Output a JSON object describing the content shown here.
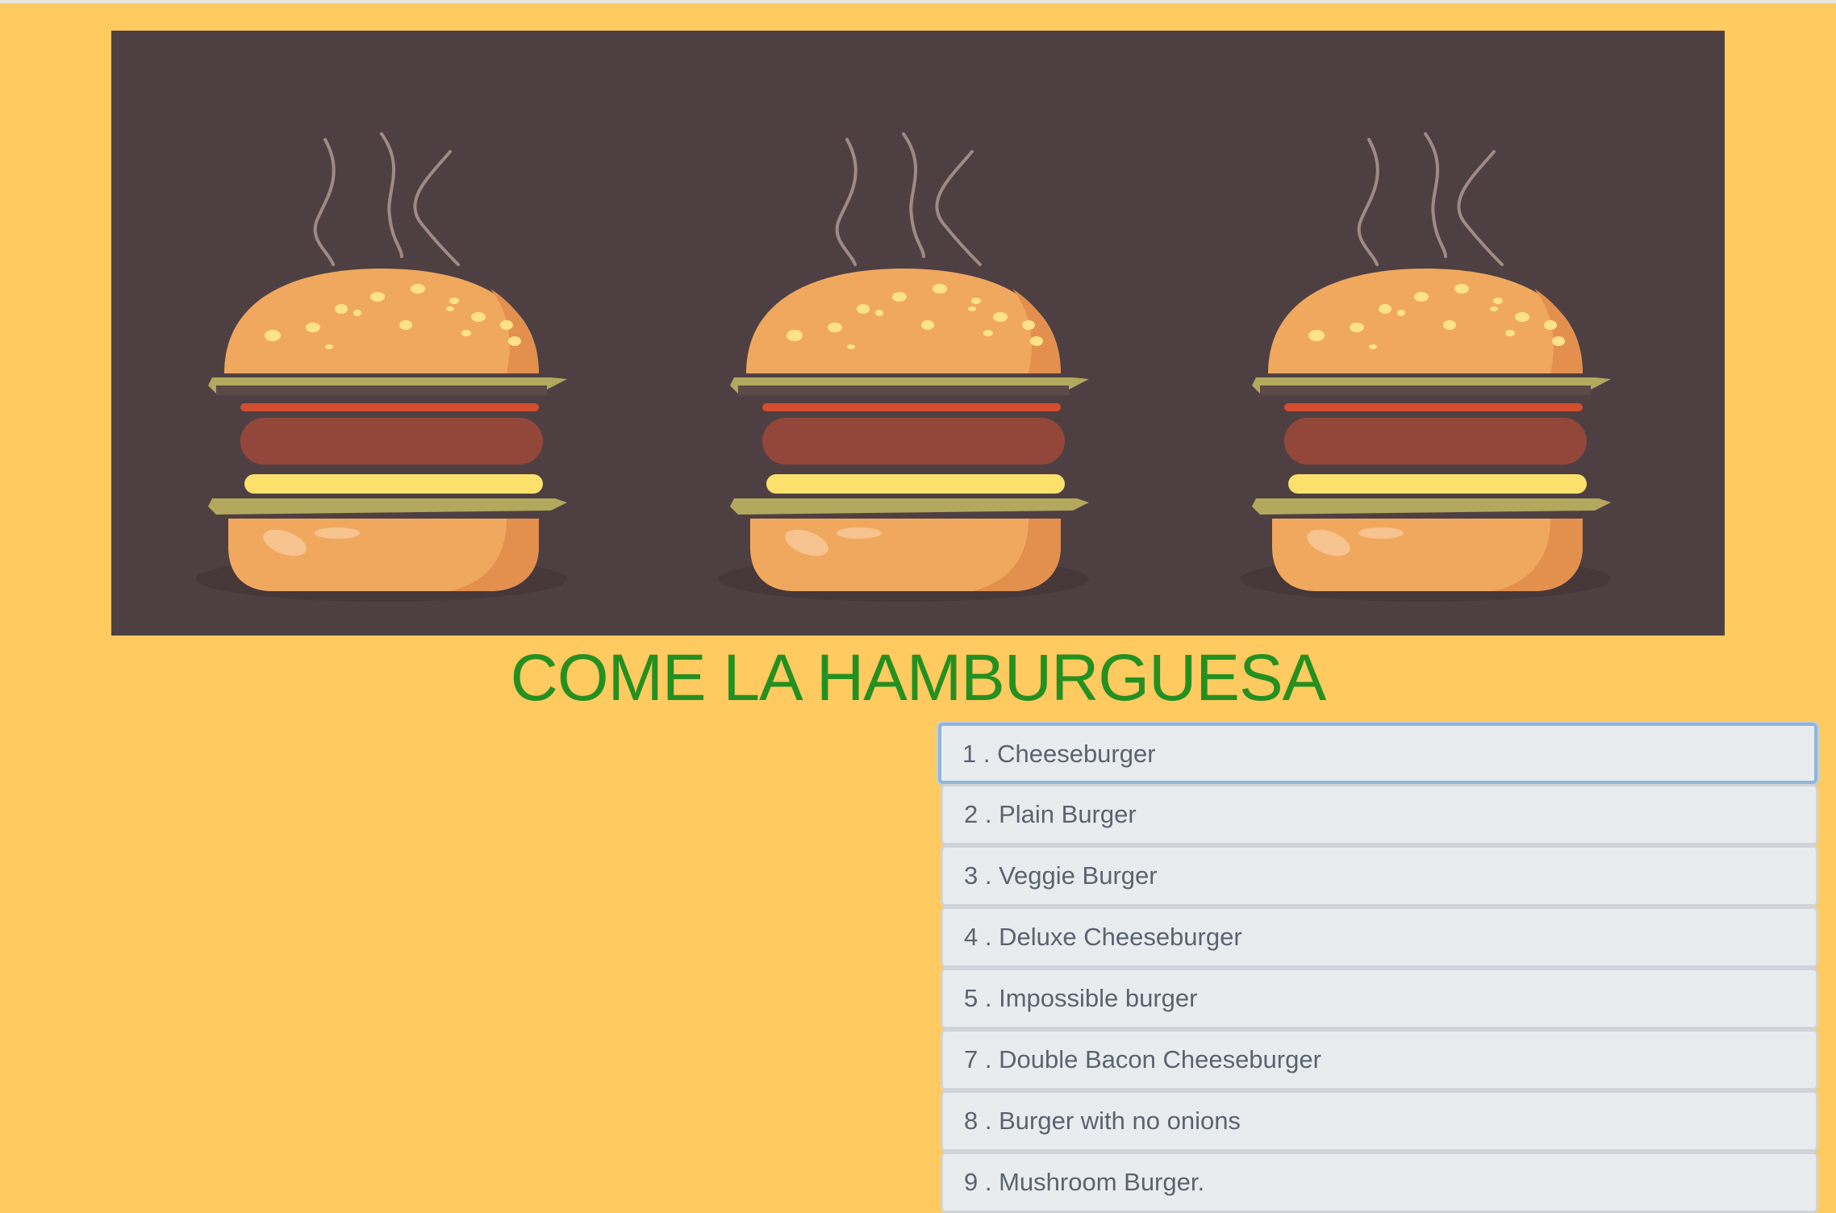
{
  "page": {
    "title": "COME LA HAMBURGUESA"
  },
  "hero": {
    "icon": "burger-banner-illustration",
    "background": "#4e4042"
  },
  "colors": {
    "page_background": "#ffca5f",
    "title": "#249021",
    "list_item_background": "#e9ecef",
    "list_item_text": "#5a6470",
    "selected_border": "#8fb6d8"
  },
  "menu": {
    "items": [
      {
        "number": "1",
        "label": "Cheeseburger",
        "selected": true
      },
      {
        "number": "2",
        "label": "Plain Burger",
        "selected": false
      },
      {
        "number": "3",
        "label": "Veggie Burger",
        "selected": false
      },
      {
        "number": "4",
        "label": "Deluxe Cheeseburger",
        "selected": false
      },
      {
        "number": "5",
        "label": "Impossible burger",
        "selected": false
      },
      {
        "number": "7",
        "label": "Double Bacon Cheeseburger",
        "selected": false
      },
      {
        "number": "8",
        "label": "Burger with no onions",
        "selected": false
      },
      {
        "number": "9",
        "label": "Mushroom Burger.",
        "selected": false
      }
    ]
  }
}
